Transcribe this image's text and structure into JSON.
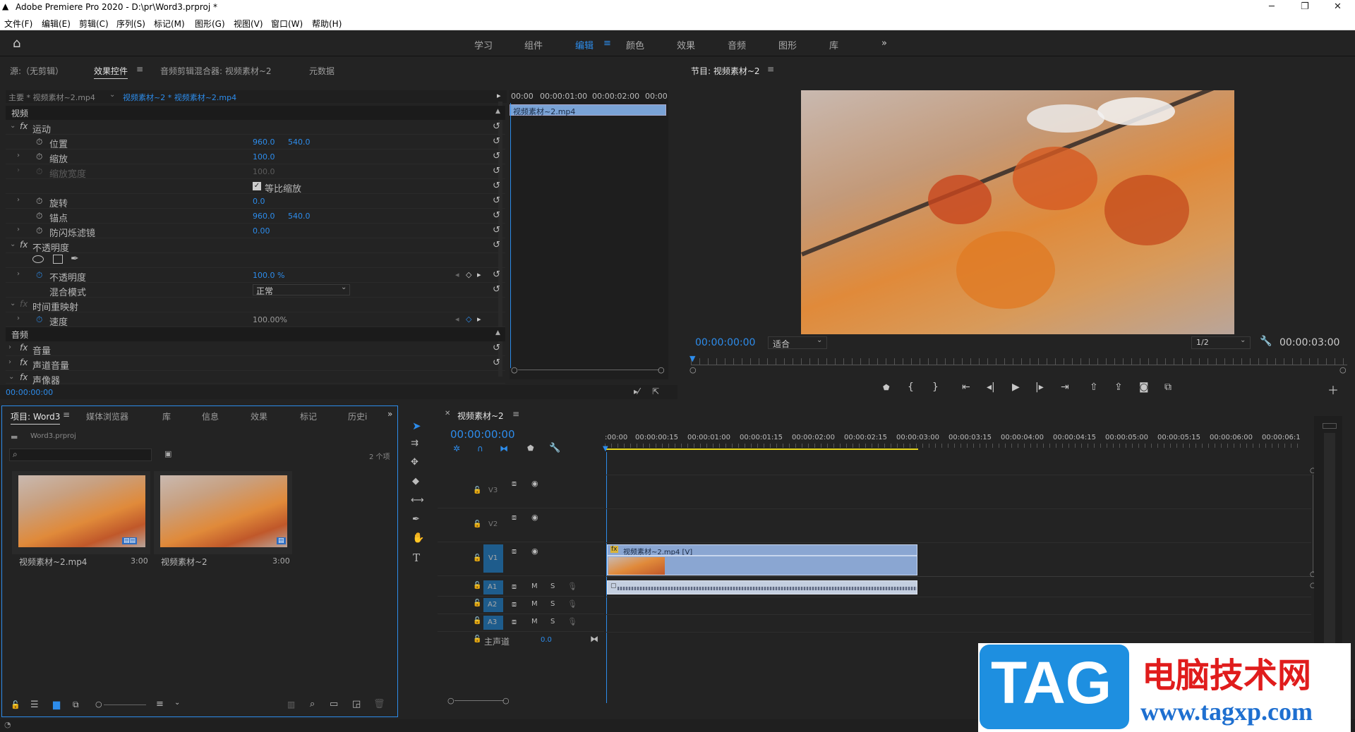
{
  "app": {
    "title": "Adobe Premiere Pro 2020 - D:\\pr\\Word3.prproj *"
  },
  "menu": [
    "文件(F)",
    "编辑(E)",
    "剪辑(C)",
    "序列(S)",
    "标记(M)",
    "图形(G)",
    "视图(V)",
    "窗口(W)",
    "帮助(H)"
  ],
  "workspaces": {
    "items": [
      "学习",
      "组件",
      "编辑",
      "颜色",
      "效果",
      "音频",
      "图形",
      "库"
    ],
    "active": "编辑",
    "more": "»"
  },
  "source_panel": {
    "tabs": [
      "源:（无剪辑）",
      "效果控件",
      "音频剪辑混合器: 视频素材~2",
      "元数据"
    ],
    "active_tab": "效果控件",
    "master_label": "主要 * 视频素材~2.mp4",
    "clip_label": "视频素材~2 * 视频素材~2.mp4",
    "ruler": [
      "00:00",
      "00:00:01:00",
      "00:00:02:00",
      "00:00"
    ],
    "clip_bar": "视频素材~2.mp4",
    "timecode": "00:00:00:00",
    "video_section": "视频",
    "audio_section": "音频",
    "motion": "运动",
    "position": {
      "label": "位置",
      "x": "960.0",
      "y": "540.0"
    },
    "scale": {
      "label": "缩放",
      "value": "100.0"
    },
    "scale_width": {
      "label": "缩放宽度",
      "value": "100.0"
    },
    "uniform": {
      "label": "等比缩放"
    },
    "rotation": {
      "label": "旋转",
      "value": "0.0"
    },
    "anchor": {
      "label": "锚点",
      "x": "960.0",
      "y": "540.0"
    },
    "flicker": {
      "label": "防闪烁滤镜",
      "value": "0.00"
    },
    "opacity_group": "不透明度",
    "opacity": {
      "label": "不透明度",
      "value": "100.0 %"
    },
    "blend": {
      "label": "混合模式",
      "value": "正常"
    },
    "time_remap": "时间重映射",
    "speed": {
      "label": "速度",
      "value": "100.00%"
    },
    "volume": "音量",
    "channel_volume": "声道音量",
    "panner": "声像器"
  },
  "program_panel": {
    "title": "节目: 视频素材~2",
    "timecode": "00:00:00:00",
    "fit": "适合",
    "quality": "1/2",
    "duration": "00:00:03:00"
  },
  "project_panel": {
    "tabs": [
      "项目: Word3",
      "媒体浏览器",
      "库",
      "信息",
      "效果",
      "标记",
      "历史i"
    ],
    "active_tab": "项目: Word3",
    "file": "Word3.prproj",
    "count": "2 个项",
    "items": [
      {
        "name": "视频素材~2.mp4",
        "dur": "3:00"
      },
      {
        "name": "视频素材~2",
        "dur": "3:00"
      }
    ]
  },
  "timeline": {
    "title": "视频素材~2",
    "timecode": "00:00:00:00",
    "ruler": [
      ":00:00",
      "00:00:00:15",
      "00:00:01:00",
      "00:00:01:15",
      "00:00:02:00",
      "00:00:02:15",
      "00:00:03:00",
      "00:00:03:15",
      "00:00:04:00",
      "00:00:04:15",
      "00:00:05:00",
      "00:00:05:15",
      "00:00:06:00",
      "00:00:06:1"
    ],
    "tracks_v": [
      "V3",
      "V2",
      "V1"
    ],
    "tracks_a": [
      "A1",
      "A2",
      "A3"
    ],
    "m": "M",
    "s": "S",
    "master": "主声道",
    "master_val": "0.0",
    "clip_label": "视频素材~2.mp4 [V]"
  },
  "watermark": {
    "tag": "TAG",
    "cn": "电脑技术网",
    "url": "www.tagxp.com"
  },
  "colors": {
    "accent": "#2d8ceb",
    "clip": "#8aa6d2",
    "audio": "#c4cfe0"
  }
}
